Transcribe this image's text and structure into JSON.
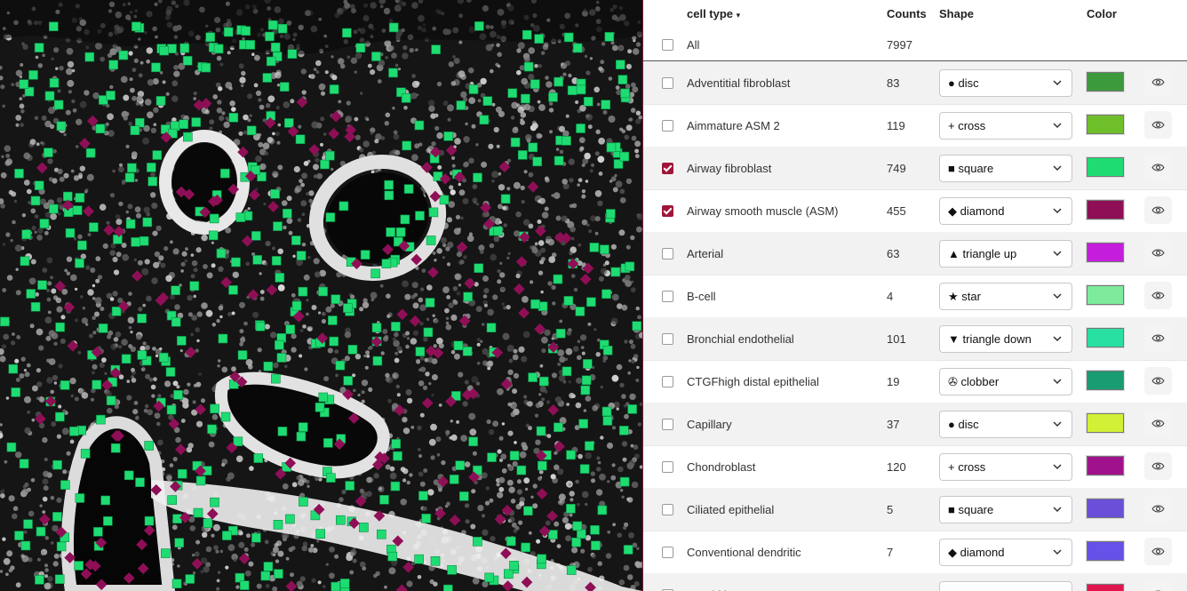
{
  "header": {
    "cell_type": "cell type",
    "sort_arrow": "▾",
    "counts": "Counts",
    "shape": "Shape",
    "color": "Color"
  },
  "all_row": {
    "label": "All",
    "count": "7997"
  },
  "rows": [
    {
      "name": "Adventitial fibroblast",
      "count": "83",
      "glyph": "●",
      "shape": "disc",
      "color": "#3c9a3c",
      "checked": false
    },
    {
      "name": "Aimmature ASM 2",
      "count": "119",
      "glyph": "+",
      "shape": "cross",
      "color": "#6fbf2a",
      "checked": false
    },
    {
      "name": "Airway fibroblast",
      "count": "749",
      "glyph": "■",
      "shape": "square",
      "color": "#1edc72",
      "checked": true
    },
    {
      "name": "Airway smooth muscle (ASM)",
      "count": "455",
      "glyph": "◆",
      "shape": "diamond",
      "color": "#8f0f57",
      "checked": true
    },
    {
      "name": "Arterial",
      "count": "63",
      "glyph": "▲",
      "shape": "triangle up",
      "color": "#c41edc",
      "checked": false
    },
    {
      "name": "B-cell",
      "count": "4",
      "glyph": "★",
      "shape": "star",
      "color": "#7deb9b",
      "checked": false
    },
    {
      "name": "Bronchial endothelial",
      "count": "101",
      "glyph": "▼",
      "shape": "triangle down",
      "color": "#28e0a2",
      "checked": false
    },
    {
      "name": "CTGFhigh distal epithelial",
      "count": "19",
      "glyph": "✇",
      "shape": "clobber",
      "color": "#1a9c72",
      "checked": false
    },
    {
      "name": "Capillary",
      "count": "37",
      "glyph": "●",
      "shape": "disc",
      "color": "#d2f035",
      "checked": false
    },
    {
      "name": "Chondroblast",
      "count": "120",
      "glyph": "+",
      "shape": "cross",
      "color": "#a0128c",
      "checked": false
    },
    {
      "name": "Ciliated epithelial",
      "count": "5",
      "glyph": "■",
      "shape": "square",
      "color": "#6a4fd8",
      "checked": false
    },
    {
      "name": "Conventional dendritic",
      "count": "7",
      "glyph": "◆",
      "shape": "diamond",
      "color": "#6652e8",
      "checked": false
    },
    {
      "name": "Dendritic",
      "count": "",
      "glyph": "",
      "shape": "",
      "color": "#e0164f",
      "checked": false
    }
  ],
  "icons": {
    "dropdown": "chevron-down-icon",
    "visibility": "eye-icon"
  }
}
